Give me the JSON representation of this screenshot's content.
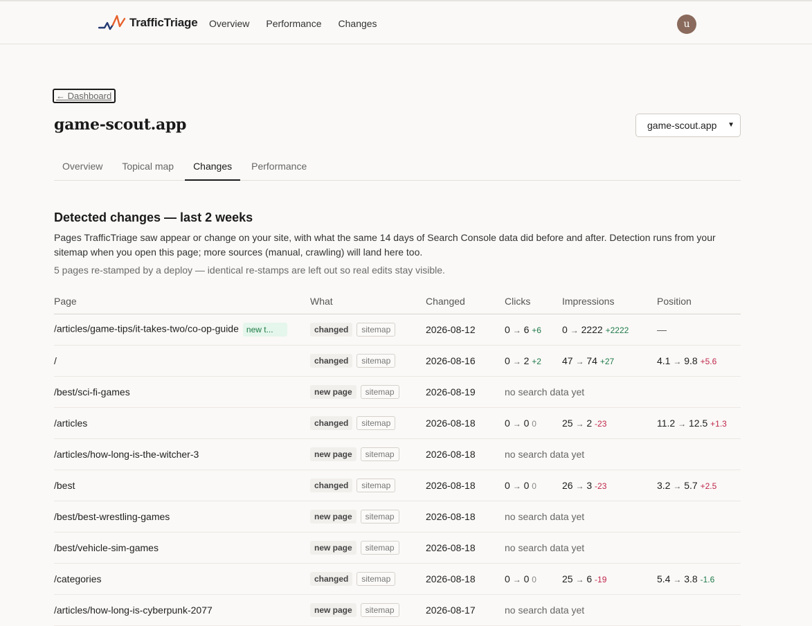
{
  "app": {
    "name": "TrafficTriage",
    "avatar_initial": "u"
  },
  "topnav": [
    "Overview",
    "Performance",
    "Changes"
  ],
  "back_link": "← Dashboard",
  "site": {
    "title": "game-scout.app",
    "selected": "game-scout.app"
  },
  "tabs": [
    {
      "label": "Overview",
      "active": false
    },
    {
      "label": "Topical map",
      "active": false
    },
    {
      "label": "Changes",
      "active": true
    },
    {
      "label": "Performance",
      "active": false
    }
  ],
  "section": {
    "title": "Detected changes — last 2 weeks",
    "description": "Pages TrafficTriage saw appear or change on your site, with what the same 14 days of Search Console data did before and after. Detection runs from your sitemap when you open this page; more sources (manual, crawling) will land here too.",
    "note": "5 pages re-stamped by a deploy — identical re-stamps are left out so real edits stay visible."
  },
  "table": {
    "headers": [
      "Page",
      "What",
      "Changed",
      "Clicks",
      "Impressions",
      "Position"
    ],
    "rows": [
      {
        "page": "/articles/game-tips/it-takes-two/co-op-guide",
        "badge": "new t...",
        "kind": "changed",
        "source": "sitemap",
        "changed": "2026-08-12",
        "clicks": {
          "before": "0",
          "after": "6",
          "delta": "+6",
          "sign": "pos"
        },
        "impressions": {
          "before": "0",
          "after": "2222",
          "delta": "+2222",
          "sign": "pos"
        },
        "position": {
          "dash": "—"
        }
      },
      {
        "page": "/",
        "kind": "changed",
        "source": "sitemap",
        "changed": "2026-08-16",
        "clicks": {
          "before": "0",
          "after": "2",
          "delta": "+2",
          "sign": "pos"
        },
        "impressions": {
          "before": "47",
          "after": "74",
          "delta": "+27",
          "sign": "pos"
        },
        "position": {
          "before": "4.1",
          "after": "9.8",
          "delta": "+5.6",
          "sign": "neg"
        }
      },
      {
        "page": "/best/sci-fi-games",
        "kind": "new page",
        "source": "sitemap",
        "changed": "2026-08-19",
        "nodata": "no search data yet"
      },
      {
        "page": "/articles",
        "kind": "changed",
        "source": "sitemap",
        "changed": "2026-08-18",
        "clicks": {
          "before": "0",
          "after": "0",
          "delta": "0",
          "sign": "zero"
        },
        "impressions": {
          "before": "25",
          "after": "2",
          "delta": "-23",
          "sign": "neg"
        },
        "position": {
          "before": "11.2",
          "after": "12.5",
          "delta": "+1.3",
          "sign": "neg"
        }
      },
      {
        "page": "/articles/how-long-is-the-witcher-3",
        "kind": "new page",
        "source": "sitemap",
        "changed": "2026-08-18",
        "nodata": "no search data yet"
      },
      {
        "page": "/best",
        "kind": "changed",
        "source": "sitemap",
        "changed": "2026-08-18",
        "clicks": {
          "before": "0",
          "after": "0",
          "delta": "0",
          "sign": "zero"
        },
        "impressions": {
          "before": "26",
          "after": "3",
          "delta": "-23",
          "sign": "neg"
        },
        "position": {
          "before": "3.2",
          "after": "5.7",
          "delta": "+2.5",
          "sign": "neg"
        }
      },
      {
        "page": "/best/best-wrestling-games",
        "kind": "new page",
        "source": "sitemap",
        "changed": "2026-08-18",
        "nodata": "no search data yet"
      },
      {
        "page": "/best/vehicle-sim-games",
        "kind": "new page",
        "source": "sitemap",
        "changed": "2026-08-18",
        "nodata": "no search data yet"
      },
      {
        "page": "/categories",
        "kind": "changed",
        "source": "sitemap",
        "changed": "2026-08-18",
        "clicks": {
          "before": "0",
          "after": "0",
          "delta": "0",
          "sign": "zero"
        },
        "impressions": {
          "before": "25",
          "after": "6",
          "delta": "-19",
          "sign": "neg"
        },
        "position": {
          "before": "5.4",
          "after": "3.8",
          "delta": "-1.6",
          "sign": "pos"
        }
      },
      {
        "page": "/articles/how-long-is-cyberpunk-2077",
        "kind": "new page",
        "source": "sitemap",
        "changed": "2026-08-17",
        "nodata": "no search data yet"
      }
    ]
  },
  "colors": {
    "accent_blue": "#243a73",
    "accent_orange": "#e8602c",
    "positive": "#1f7a4a",
    "negative": "#c0264a"
  },
  "icons": {
    "logo": "traffic-line-icon",
    "select_chevron": "chevron-down-icon"
  }
}
